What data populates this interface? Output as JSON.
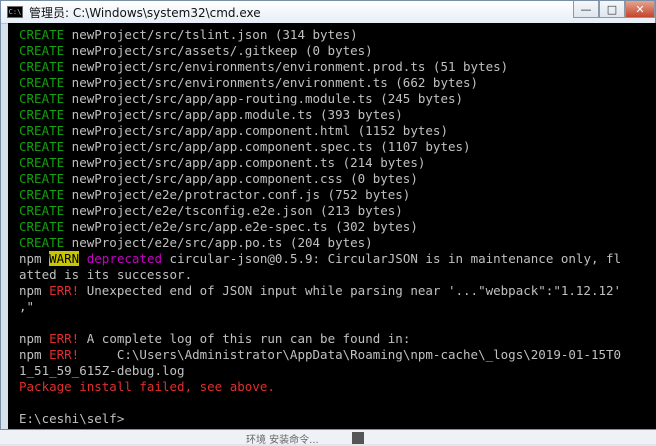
{
  "window": {
    "title": "管理员: C:\\Windows\\system32\\cmd.exe",
    "buttons": {
      "minimize": "—",
      "maximize": "□",
      "close": "✕"
    }
  },
  "console": {
    "create_lines": [
      {
        "tag": "CREATE",
        "text": " newProject/src/tslint.json (314 bytes)"
      },
      {
        "tag": "CREATE",
        "text": " newProject/src/assets/.gitkeep (0 bytes)"
      },
      {
        "tag": "CREATE",
        "text": " newProject/src/environments/environment.prod.ts (51 bytes)"
      },
      {
        "tag": "CREATE",
        "text": " newProject/src/environments/environment.ts (662 bytes)"
      },
      {
        "tag": "CREATE",
        "text": " newProject/src/app/app-routing.module.ts (245 bytes)"
      },
      {
        "tag": "CREATE",
        "text": " newProject/src/app/app.module.ts (393 bytes)"
      },
      {
        "tag": "CREATE",
        "text": " newProject/src/app/app.component.html (1152 bytes)"
      },
      {
        "tag": "CREATE",
        "text": " newProject/src/app/app.component.spec.ts (1107 bytes)"
      },
      {
        "tag": "CREATE",
        "text": " newProject/src/app/app.component.ts (214 bytes)"
      },
      {
        "tag": "CREATE",
        "text": " newProject/src/app/app.component.css (0 bytes)"
      },
      {
        "tag": "CREATE",
        "text": " newProject/e2e/protractor.conf.js (752 bytes)"
      },
      {
        "tag": "CREATE",
        "text": " newProject/e2e/tsconfig.e2e.json (213 bytes)"
      },
      {
        "tag": "CREATE",
        "text": " newProject/e2e/src/app.e2e-spec.ts (302 bytes)"
      },
      {
        "tag": "CREATE",
        "text": " newProject/e2e/src/app.po.ts (204 bytes)"
      }
    ],
    "warn_line": {
      "prefix": "npm ",
      "level": "WARN",
      "sep": " ",
      "kind": "deprecated",
      "message": " circular-json@0.5.9: CircularJSON is in maintenance only, fl",
      "continuation": "atted is its successor."
    },
    "err_line_1": {
      "prefix": "npm ",
      "level": "ERR!",
      "message": " Unexpected end of JSON input while parsing near '...\"webpack\":\"1.12.12'",
      "continuation": ",\""
    },
    "blank_1": " ",
    "err_line_2": {
      "prefix": "npm ",
      "level": "ERR!",
      "message": " A complete log of this run can be found in:"
    },
    "err_line_3": {
      "prefix": "npm ",
      "level": "ERR!",
      "message": "     C:\\Users\\Administrator\\AppData\\Roaming\\npm-cache\\_logs\\2019-01-15T0",
      "continuation": "1_51_59_615Z-debug.log"
    },
    "failure": "Package install failed, see above.",
    "blank_2": " ",
    "prompt": "E:\\ceshi\\self>"
  },
  "background": {
    "partial_text": "环境 安装命令..."
  },
  "colors": {
    "create_tag": "#13a10e",
    "warn_bg": "#c8c600",
    "deprecated": "#c400c4",
    "error": "#e12d2d",
    "text": "#c0c0c0",
    "console_bg": "#000000"
  }
}
